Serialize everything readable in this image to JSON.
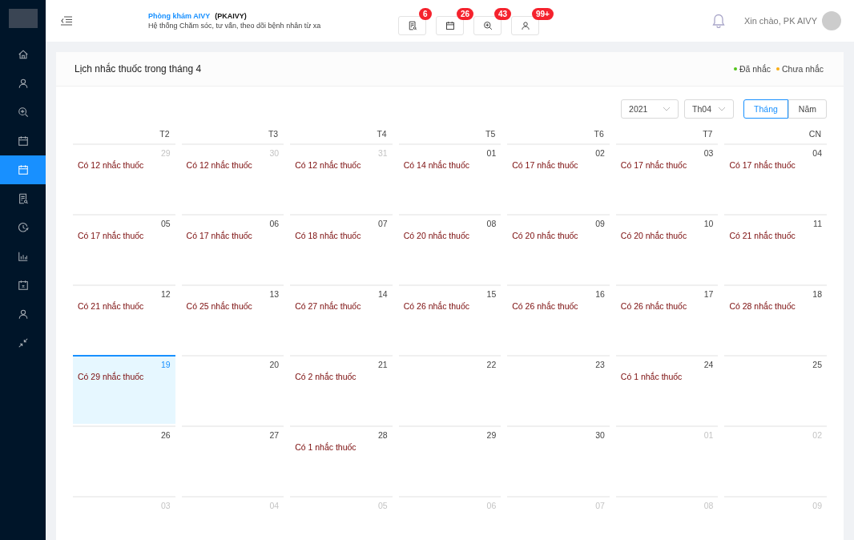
{
  "sidebar": {
    "items": [
      {
        "selected": false
      },
      {
        "selected": false
      },
      {
        "selected": false
      },
      {
        "selected": false
      },
      {
        "selected": true
      },
      {
        "selected": false
      },
      {
        "selected": false
      },
      {
        "selected": false
      },
      {
        "selected": false
      },
      {
        "selected": false
      },
      {
        "selected": false
      }
    ]
  },
  "header": {
    "clinic_name": "Phòng khám AIVY",
    "clinic_code": "(PKAIVY)",
    "subtitle": "Hệ thống Chăm sóc, tư vấn, theo dõi bệnh nhân từ xa",
    "shortcuts": [
      {
        "badge": "6"
      },
      {
        "badge": "26"
      },
      {
        "badge": "43"
      },
      {
        "badge": "99+"
      }
    ],
    "greeting": "Xin chào, PK AIVY"
  },
  "card": {
    "title": "Lịch nhắc thuốc trong tháng 4",
    "legend": [
      {
        "label": "Đã nhắc",
        "color": "#52c41a"
      },
      {
        "label": "Chưa nhắc",
        "color": "#faad14"
      }
    ],
    "year_select": "2021",
    "month_select": "Th04",
    "modes": [
      {
        "label": "Tháng",
        "selected": true
      },
      {
        "label": "Năm",
        "selected": false
      }
    ],
    "weekdays": [
      "T2",
      "T3",
      "T4",
      "T5",
      "T6",
      "T7",
      "CN"
    ],
    "weeks": [
      [
        {
          "day": "29",
          "in_month": false,
          "selected": false,
          "note": "Có 12 nhắc thuốc"
        },
        {
          "day": "30",
          "in_month": false,
          "selected": false,
          "note": "Có 12 nhắc thuốc"
        },
        {
          "day": "31",
          "in_month": false,
          "selected": false,
          "note": "Có 12 nhắc thuốc"
        },
        {
          "day": "01",
          "in_month": true,
          "selected": false,
          "note": "Có 14 nhắc thuốc"
        },
        {
          "day": "02",
          "in_month": true,
          "selected": false,
          "note": "Có 17 nhắc thuốc"
        },
        {
          "day": "03",
          "in_month": true,
          "selected": false,
          "note": "Có 17 nhắc thuốc"
        },
        {
          "day": "04",
          "in_month": true,
          "selected": false,
          "note": "Có 17 nhắc thuốc"
        }
      ],
      [
        {
          "day": "05",
          "in_month": true,
          "selected": false,
          "note": "Có 17 nhắc thuốc"
        },
        {
          "day": "06",
          "in_month": true,
          "selected": false,
          "note": "Có 17 nhắc thuốc"
        },
        {
          "day": "07",
          "in_month": true,
          "selected": false,
          "note": "Có 18 nhắc thuốc"
        },
        {
          "day": "08",
          "in_month": true,
          "selected": false,
          "note": "Có 20 nhắc thuốc"
        },
        {
          "day": "09",
          "in_month": true,
          "selected": false,
          "note": "Có 20 nhắc thuốc"
        },
        {
          "day": "10",
          "in_month": true,
          "selected": false,
          "note": "Có 20 nhắc thuốc"
        },
        {
          "day": "11",
          "in_month": true,
          "selected": false,
          "note": "Có 21 nhắc thuốc"
        }
      ],
      [
        {
          "day": "12",
          "in_month": true,
          "selected": false,
          "note": "Có 21 nhắc thuốc"
        },
        {
          "day": "13",
          "in_month": true,
          "selected": false,
          "note": "Có 25 nhắc thuốc"
        },
        {
          "day": "14",
          "in_month": true,
          "selected": false,
          "note": "Có 27 nhắc thuốc"
        },
        {
          "day": "15",
          "in_month": true,
          "selected": false,
          "note": "Có 26 nhắc thuốc"
        },
        {
          "day": "16",
          "in_month": true,
          "selected": false,
          "note": "Có 26 nhắc thuốc"
        },
        {
          "day": "17",
          "in_month": true,
          "selected": false,
          "note": "Có 26 nhắc thuốc"
        },
        {
          "day": "18",
          "in_month": true,
          "selected": false,
          "note": "Có 28 nhắc thuốc"
        }
      ],
      [
        {
          "day": "19",
          "in_month": true,
          "selected": true,
          "note": "Có 29 nhắc thuốc"
        },
        {
          "day": "20",
          "in_month": true,
          "selected": false
        },
        {
          "day": "21",
          "in_month": true,
          "selected": false,
          "note": "Có 2 nhắc thuốc"
        },
        {
          "day": "22",
          "in_month": true,
          "selected": false
        },
        {
          "day": "23",
          "in_month": true,
          "selected": false
        },
        {
          "day": "24",
          "in_month": true,
          "selected": false,
          "note": "Có 1 nhắc thuốc"
        },
        {
          "day": "25",
          "in_month": true,
          "selected": false
        }
      ],
      [
        {
          "day": "26",
          "in_month": true,
          "selected": false
        },
        {
          "day": "27",
          "in_month": true,
          "selected": false
        },
        {
          "day": "28",
          "in_month": true,
          "selected": false,
          "note": "Có 1 nhắc thuốc"
        },
        {
          "day": "29",
          "in_month": true,
          "selected": false
        },
        {
          "day": "30",
          "in_month": true,
          "selected": false
        },
        {
          "day": "01",
          "in_month": false,
          "selected": false
        },
        {
          "day": "02",
          "in_month": false,
          "selected": false
        }
      ],
      [
        {
          "day": "03",
          "in_month": false,
          "selected": false
        },
        {
          "day": "04",
          "in_month": false,
          "selected": false
        },
        {
          "day": "05",
          "in_month": false,
          "selected": false
        },
        {
          "day": "06",
          "in_month": false,
          "selected": false
        },
        {
          "day": "07",
          "in_month": false,
          "selected": false
        },
        {
          "day": "08",
          "in_month": false,
          "selected": false
        },
        {
          "day": "09",
          "in_month": false,
          "selected": false
        }
      ]
    ]
  }
}
